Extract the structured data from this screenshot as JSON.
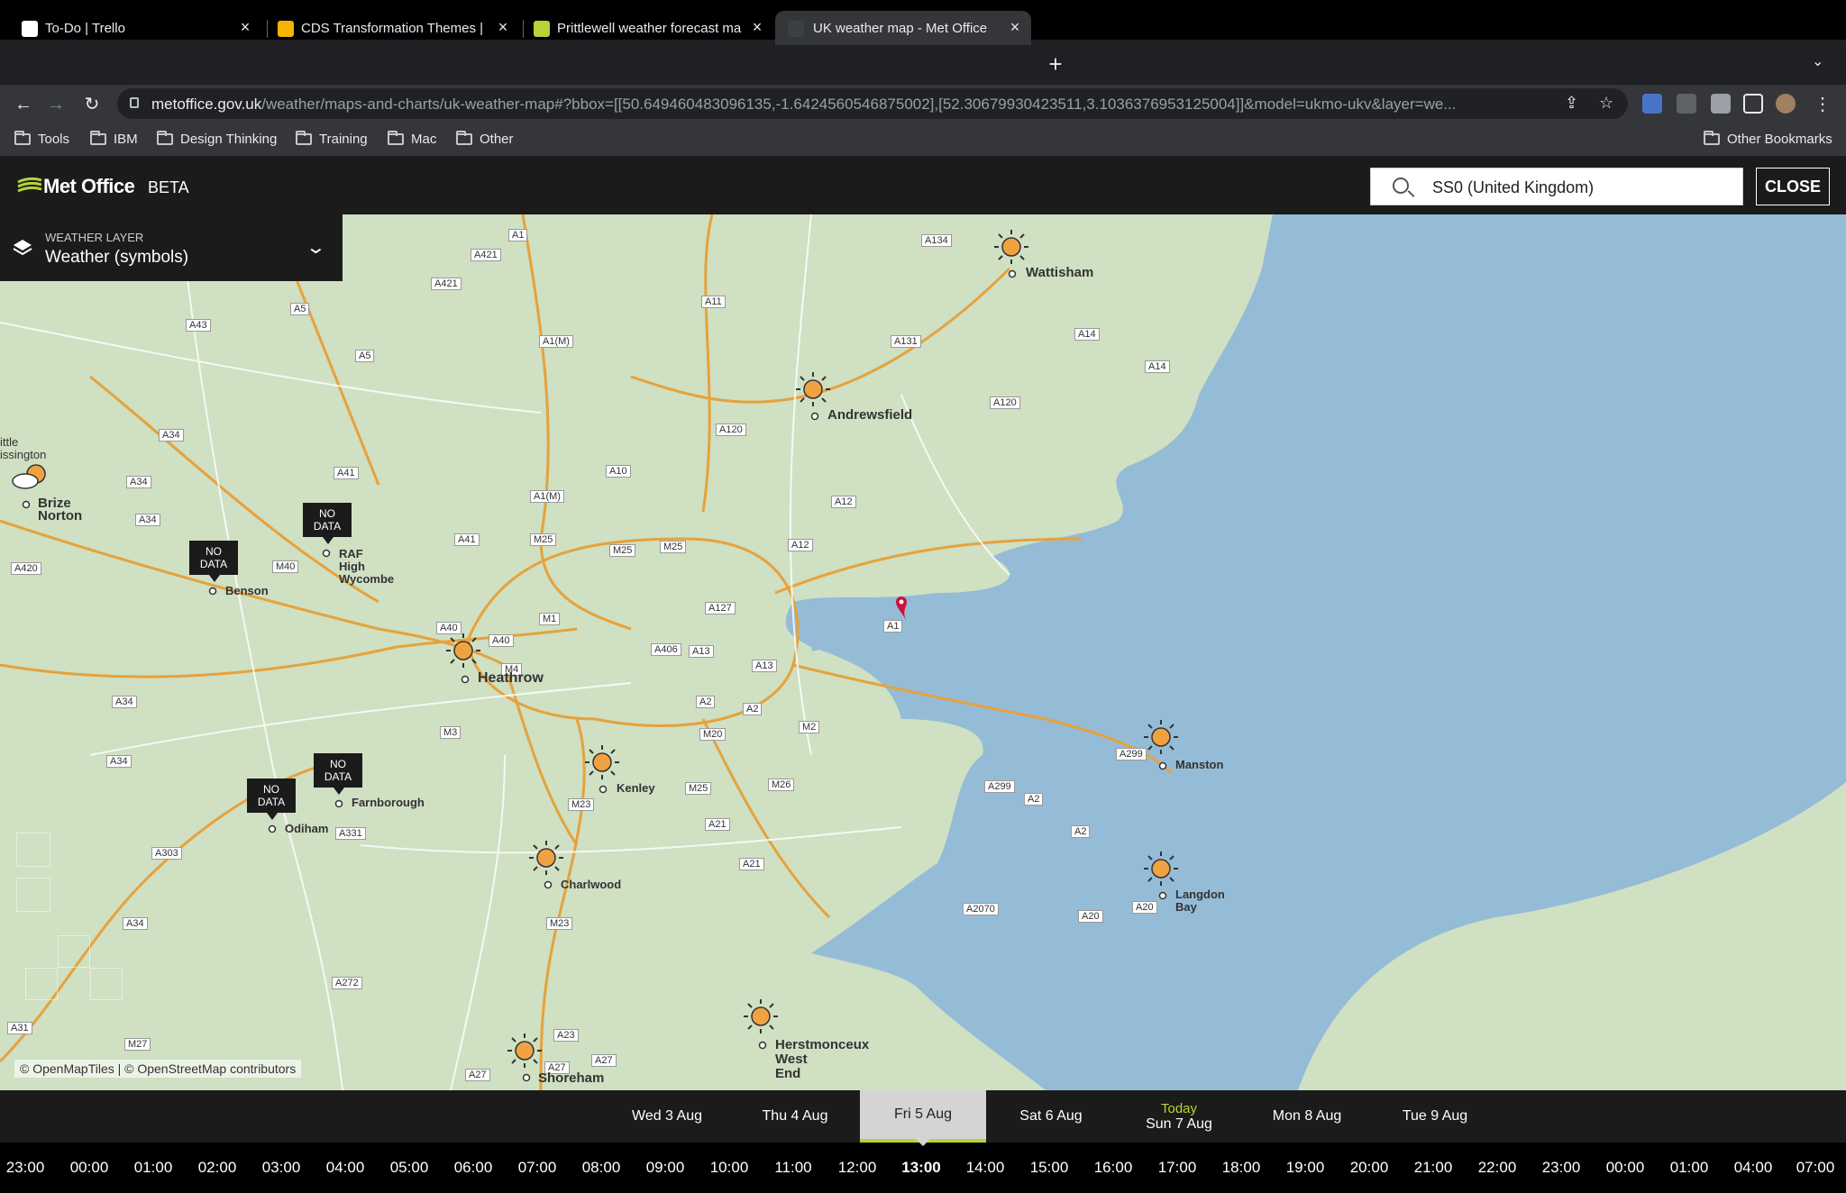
{
  "browser": {
    "tabs": [
      {
        "label": "To-Do | Trello",
        "favicon_color": "#ffffff"
      },
      {
        "label": "CDS Transformation Themes | T",
        "favicon_color": "#f4b400"
      },
      {
        "label": "Prittlewell weather forecast ma",
        "favicon_color": "#b6d43a"
      },
      {
        "label": "UK weather map - Met Office",
        "favicon_color": "#3c4043"
      }
    ],
    "url_host": "metoffice.gov.uk",
    "url_path": "/weather/maps-and-charts/uk-weather-map#?bbox=[[50.649460483096135,-1.6424560546875002],[52.30679930423511,3.1036376953125004]]&model=ukmo-ukv&layer=we...",
    "bookmarks": [
      "Tools",
      "IBM",
      "Design Thinking",
      "Training",
      "Mac",
      "Other"
    ],
    "other_bookmarks": "Other Bookmarks"
  },
  "header": {
    "logo": "Met Office",
    "beta": "BETA",
    "search_value": "SS0 (United Kingdom)",
    "close_label": "CLOSE"
  },
  "layer": {
    "label": "WEATHER LAYER",
    "value": "Weather (symbols)"
  },
  "map": {
    "cities": {
      "wattisham": "Wattisham",
      "andrewsfield": "Andrewsfield",
      "brize": "Brize\nNorton",
      "little": "ittle\nissington",
      "raf": "RAF\nHigh\nWycombe",
      "benson": "Benson",
      "heathrow": "Heathrow",
      "kenley": "Kenley",
      "farnborough": "Farnborough",
      "odiham": "Odiham",
      "charlwood": "Charlwood",
      "manston": "Manston",
      "langdon": "Langdon\nBay",
      "herstmonceux": "Herstmonceux\nWest\nEnd",
      "shoreham": "Shoreham"
    },
    "nodata": "NO\nDATA",
    "attribution": "© OpenMapTiles | © OpenStreetMap contributors",
    "roads": [
      "A1",
      "A134",
      "A421",
      "A11",
      "A421",
      "A5",
      "A43",
      "A5",
      "A1(M)",
      "A131",
      "A14",
      "A14",
      "A120",
      "A120",
      "A120",
      "A34",
      "A41",
      "A10",
      "A34",
      "A1(M)",
      "A12",
      "A34",
      "A41",
      "M25",
      "M25",
      "M25",
      "A12",
      "A420",
      "M40",
      "A127",
      "A40",
      "A40",
      "M1",
      "A406",
      "A13",
      "A13",
      "A1",
      "M4",
      "A34",
      "A2",
      "A2",
      "M3",
      "M20",
      "M2",
      "A299",
      "A34",
      "M25",
      "M26",
      "A299",
      "A2",
      "M23",
      "A331",
      "A303",
      "A21",
      "A2",
      "A21",
      "A2070",
      "A20",
      "A20",
      "A34",
      "M23",
      "A272",
      "A31",
      "M27",
      "A23",
      "A27",
      "A27",
      "A27"
    ]
  },
  "timeline": {
    "days": [
      {
        "label": "Wed 3 Aug"
      },
      {
        "label": "Thu 4 Aug"
      },
      {
        "label": "Fri 5 Aug"
      },
      {
        "label": "Sat 6 Aug"
      },
      {
        "today": "Today",
        "label": "Sun 7 Aug"
      },
      {
        "label": "Mon 8 Aug"
      },
      {
        "label": "Tue 9 Aug"
      }
    ],
    "selected_day": "Fri 5 Aug",
    "hours": [
      "23:00",
      "00:00",
      "01:00",
      "02:00",
      "03:00",
      "04:00",
      "05:00",
      "06:00",
      "07:00",
      "08:00",
      "09:00",
      "10:00",
      "11:00",
      "12:00",
      "13:00",
      "14:00",
      "15:00",
      "16:00",
      "17:00",
      "18:00",
      "19:00",
      "20:00",
      "21:00",
      "22:00",
      "23:00",
      "00:00",
      "01:00",
      "04:00",
      "07:00"
    ],
    "selected_hour": "13:00"
  },
  "colors": {
    "land": "#cfe0c3",
    "sea": "#95bcd6",
    "accent": "#b6d43a",
    "sun": "#f0a241",
    "pin": "#d0103a"
  }
}
